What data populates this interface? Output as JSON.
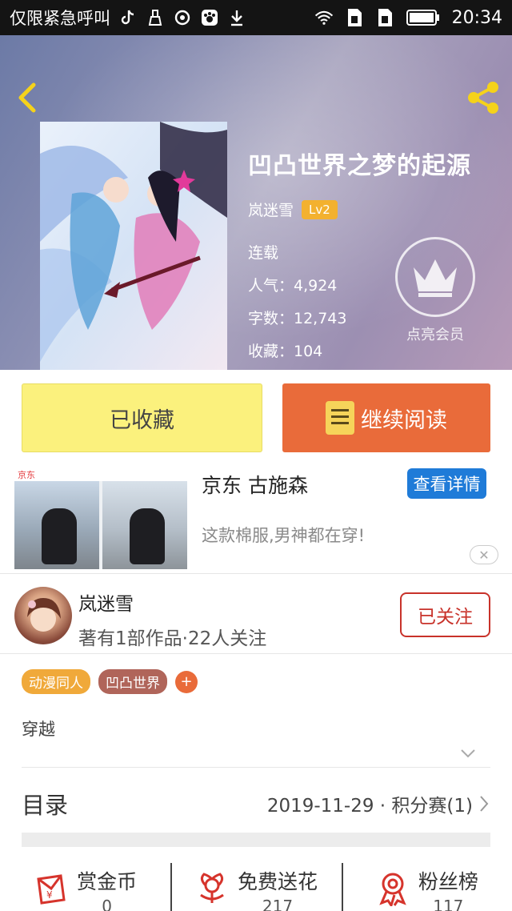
{
  "status_bar": {
    "carrier": "仅限紧急呼叫",
    "time": "20:34"
  },
  "book": {
    "title": "凹凸世界之梦的起源",
    "author": "岚迷雪",
    "level": "Lv2",
    "status": "连载",
    "popularity": "人气：4,924",
    "word_count": "字数：12,743",
    "favorites": "收藏：104",
    "membership_label": "点亮会员"
  },
  "actions": {
    "collected_label": "已收藏",
    "continue_label": "继续阅读"
  },
  "ad": {
    "brand_tag": "京东",
    "title": "京东 古施森",
    "detail_label": "查看详情",
    "description": "这款棉服,男神都在穿!",
    "close_symbol": "✕"
  },
  "author_card": {
    "name": "岚迷雪",
    "stats": "著有1部作品·22人关注",
    "follow_label": "已关注"
  },
  "tags": [
    {
      "label": "动漫同人",
      "color": "#f0a93a"
    },
    {
      "label": "凹凸世界",
      "color": "#b0655a"
    }
  ],
  "tag_add_symbol": "+",
  "synopsis": "穿越",
  "toc": {
    "title": "目录",
    "latest": "2019-11-29 · 积分赛(1)"
  },
  "stats": [
    {
      "label": "赏金币",
      "value": "0",
      "icon": "red-packet-icon"
    },
    {
      "label": "免费送花",
      "value": "217",
      "icon": "flower-icon"
    },
    {
      "label": "粉丝榜",
      "value": "117",
      "icon": "medal-icon"
    }
  ],
  "colors": {
    "accent_orange": "#e96b3a",
    "collected_yellow": "#fbf17d",
    "follow_red": "#c8322a",
    "level_badge": "#f3b12f",
    "detail_blue": "#1f7bd8"
  }
}
